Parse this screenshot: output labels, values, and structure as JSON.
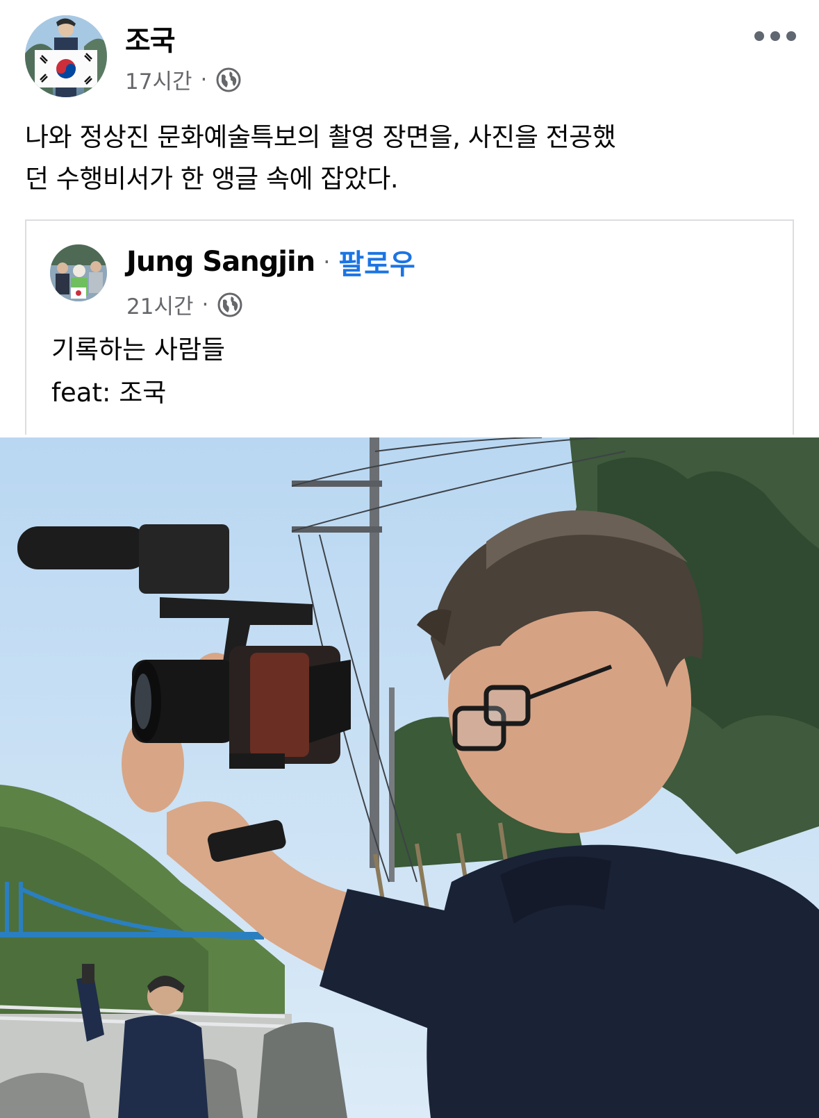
{
  "post": {
    "author": "조국",
    "time": "17시간",
    "separator": "·",
    "text_line1": "나와 정상진 문화예술특보의 촬영 장면을, 사진을 전공했",
    "text_line2": "던 수행비서가 한 앵글 속에 잡았다."
  },
  "shared_post": {
    "author": "Jung Sangjin",
    "separator": "·",
    "follow_label": "팔로우",
    "time": "21시간",
    "text_line1": "기록하는 사람들",
    "text_line2": "feat: 조국"
  },
  "icons": {
    "privacy": "globe-icon",
    "menu": "more-options-icon"
  },
  "colors": {
    "follow_link": "#1b74e4",
    "meta_text": "#65676b",
    "card_border": "#dadde1"
  }
}
